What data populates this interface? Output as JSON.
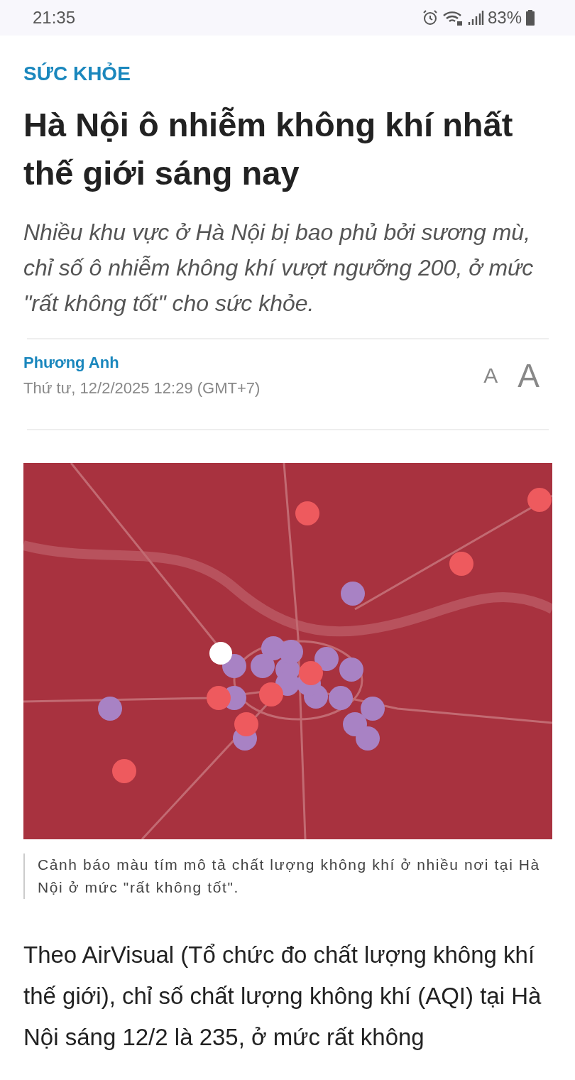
{
  "status_bar": {
    "time": "21:35",
    "battery": "83%"
  },
  "article": {
    "category": "SỨC KHỎE",
    "title": "Hà Nội ô nhiễm không khí nhất thế giới sáng nay",
    "lead": "Nhiều khu vực ở Hà Nội bị bao phủ bởi sương mù, chỉ số ô nhiễm không khí vượt ngưỡng 200, ở mức \"rất không tốt\" cho sức khỏe.",
    "author": "Phương Anh",
    "date": "Thứ tư, 12/2/2025 12:29 (GMT+7)",
    "font_small": "A",
    "font_large": "A",
    "image": {
      "kind": "picture",
      "caption": "Cảnh báo màu tím mô tả chất lượng không khí ở nhiều nơi tại Hà Nội ở mức \"rất không tốt\"."
    },
    "body": "Theo AirVisual (Tổ chức đo chất lượng không khí thế giới), chỉ số chất lượng không khí (AQI) tại Hà Nội sáng 12/2 là 235, ở mức rất không"
  }
}
